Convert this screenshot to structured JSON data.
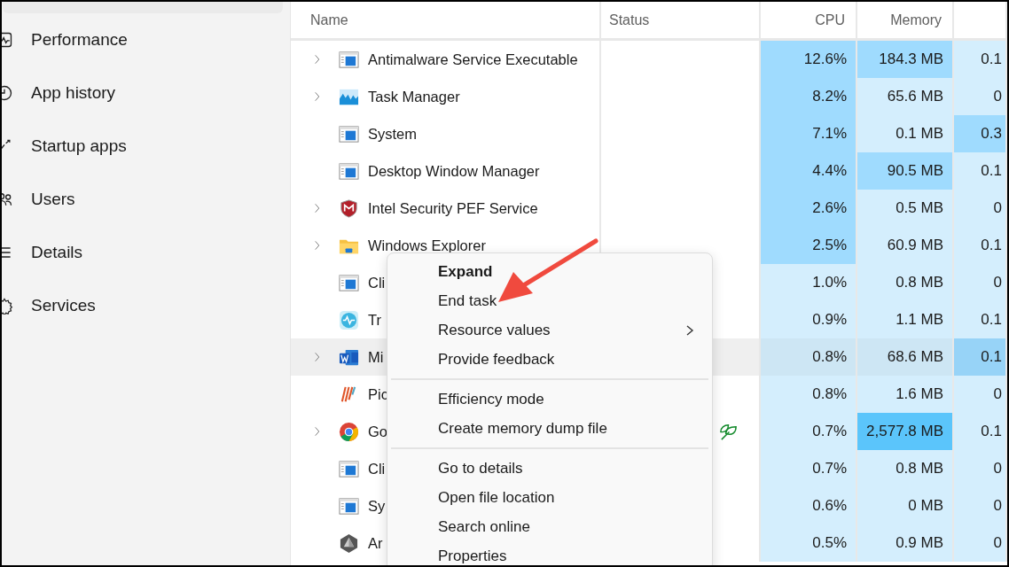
{
  "sidebar": {
    "items": [
      {
        "label": "Performance",
        "kind": "performance"
      },
      {
        "label": "App history",
        "kind": "history"
      },
      {
        "label": "Startup apps",
        "kind": "startup"
      },
      {
        "label": "Users",
        "kind": "users"
      },
      {
        "label": "Details",
        "kind": "details"
      },
      {
        "label": "Services",
        "kind": "services"
      }
    ]
  },
  "table": {
    "columns": [
      {
        "label": "Name"
      },
      {
        "label": "Status"
      },
      {
        "label": "CPU"
      },
      {
        "label": "Memory"
      }
    ],
    "rows": [
      {
        "name": "Antimalware Service Executable",
        "kind": "window",
        "expandable": true,
        "selected": false,
        "efficiency": false,
        "cpu": {
          "text": "12.6%",
          "color": "#9fdbfe"
        },
        "memory": {
          "text": "184.3 MB",
          "color": "#9fdbfe"
        },
        "column_5": {
          "text": "0.1",
          "color": "#d4eefd"
        }
      },
      {
        "name": "Task Manager",
        "kind": "monitor",
        "expandable": true,
        "selected": false,
        "efficiency": false,
        "cpu": {
          "text": "8.2%",
          "color": "#9fdbfe"
        },
        "memory": {
          "text": "65.6 MB",
          "color": "#d4eefd"
        },
        "column_5": {
          "text": "0",
          "color": "#d4eefd"
        }
      },
      {
        "name": "System",
        "kind": "window",
        "expandable": false,
        "selected": false,
        "efficiency": false,
        "cpu": {
          "text": "7.1%",
          "color": "#9fdbfe"
        },
        "memory": {
          "text": "0.1 MB",
          "color": "#d4eefd"
        },
        "column_5": {
          "text": "0.3",
          "color": "#9fdbfe"
        }
      },
      {
        "name": "Desktop Window Manager",
        "kind": "window",
        "expandable": false,
        "selected": false,
        "efficiency": false,
        "cpu": {
          "text": "4.4%",
          "color": "#9fdbfe"
        },
        "memory": {
          "text": "90.5 MB",
          "color": "#9fdbfe"
        },
        "column_5": {
          "text": "0.1",
          "color": "#d4eefd"
        }
      },
      {
        "name": "Intel Security PEF Service",
        "kind": "shield",
        "expandable": true,
        "selected": false,
        "efficiency": false,
        "cpu": {
          "text": "2.6%",
          "color": "#9fdbfe"
        },
        "memory": {
          "text": "0.5 MB",
          "color": "#d4eefd"
        },
        "column_5": {
          "text": "0",
          "color": "#d4eefd"
        }
      },
      {
        "name": "Windows Explorer",
        "kind": "folder",
        "expandable": true,
        "selected": false,
        "efficiency": false,
        "cpu": {
          "text": "2.5%",
          "color": "#9fdbfe"
        },
        "memory": {
          "text": "60.9 MB",
          "color": "#d4eefd"
        },
        "column_5": {
          "text": "0.1",
          "color": "#d4eefd"
        }
      },
      {
        "name": "Cli",
        "kind": "window",
        "expandable": false,
        "selected": false,
        "efficiency": false,
        "cpu": {
          "text": "1.0%",
          "color": "#d4eefd"
        },
        "memory": {
          "text": "0.8 MB",
          "color": "#d4eefd"
        },
        "column_5": {
          "text": "0",
          "color": "#d4eefd"
        }
      },
      {
        "name": "Tr",
        "kind": "pulse",
        "expandable": false,
        "selected": false,
        "efficiency": false,
        "cpu": {
          "text": "0.9%",
          "color": "#d4eefd"
        },
        "memory": {
          "text": "1.1 MB",
          "color": "#d4eefd"
        },
        "column_5": {
          "text": "0.1",
          "color": "#d4eefd"
        }
      },
      {
        "name": "Mi",
        "kind": "document",
        "expandable": true,
        "selected": true,
        "efficiency": false,
        "cpu": {
          "text": "0.8%",
          "color": "#cde6f4"
        },
        "memory": {
          "text": "68.6 MB",
          "color": "#cde6f4"
        },
        "column_5": {
          "text": "0.1",
          "color": "#97d3f7"
        }
      },
      {
        "name": "Pic",
        "kind": "stripes",
        "expandable": false,
        "selected": false,
        "efficiency": false,
        "cpu": {
          "text": "0.8%",
          "color": "#d4eefd"
        },
        "memory": {
          "text": "1.6 MB",
          "color": "#d4eefd"
        },
        "column_5": {
          "text": "0",
          "color": "#d4eefd"
        }
      },
      {
        "name": "Go",
        "kind": "browser",
        "expandable": true,
        "selected": false,
        "efficiency": true,
        "cpu": {
          "text": "0.7%",
          "color": "#d4eefd"
        },
        "memory": {
          "text": "2,577.8 MB",
          "color": "#5bc5fb"
        },
        "column_5": {
          "text": "0.1",
          "color": "#d4eefd"
        }
      },
      {
        "name": "Cli",
        "kind": "window",
        "expandable": false,
        "selected": false,
        "efficiency": false,
        "cpu": {
          "text": "0.7%",
          "color": "#d4eefd"
        },
        "memory": {
          "text": "0.8 MB",
          "color": "#d4eefd"
        },
        "column_5": {
          "text": "0",
          "color": "#d4eefd"
        }
      },
      {
        "name": "Sy",
        "kind": "window",
        "expandable": false,
        "selected": false,
        "efficiency": false,
        "cpu": {
          "text": "0.6%",
          "color": "#d4eefd"
        },
        "memory": {
          "text": "0 MB",
          "color": "#d4eefd"
        },
        "column_5": {
          "text": "0",
          "color": "#d4eefd"
        }
      },
      {
        "name": "Ar",
        "kind": "prism",
        "expandable": false,
        "selected": false,
        "efficiency": false,
        "cpu": {
          "text": "0.5%",
          "color": "#d4eefd"
        },
        "memory": {
          "text": "0.9 MB",
          "color": "#d4eefd"
        },
        "column_5": {
          "text": "0",
          "color": "#d4eefd"
        }
      }
    ]
  },
  "context_menu": {
    "items": [
      {
        "kind": "item",
        "label": "Expand",
        "bold": true,
        "submenu": false
      },
      {
        "kind": "item",
        "label": "End task",
        "bold": false,
        "submenu": false
      },
      {
        "kind": "item",
        "label": "Resource values",
        "bold": false,
        "submenu": true
      },
      {
        "kind": "item",
        "label": "Provide feedback",
        "bold": false,
        "submenu": false
      },
      {
        "kind": "separator"
      },
      {
        "kind": "item",
        "label": "Efficiency mode",
        "bold": false,
        "submenu": false
      },
      {
        "kind": "item",
        "label": "Create memory dump file",
        "bold": false,
        "submenu": false
      },
      {
        "kind": "separator"
      },
      {
        "kind": "item",
        "label": "Go to details",
        "bold": false,
        "submenu": false
      },
      {
        "kind": "item",
        "label": "Open file location",
        "bold": false,
        "submenu": false
      },
      {
        "kind": "item",
        "label": "Search online",
        "bold": false,
        "submenu": false
      },
      {
        "kind": "item",
        "label": "Properties",
        "bold": false,
        "submenu": false
      }
    ]
  }
}
